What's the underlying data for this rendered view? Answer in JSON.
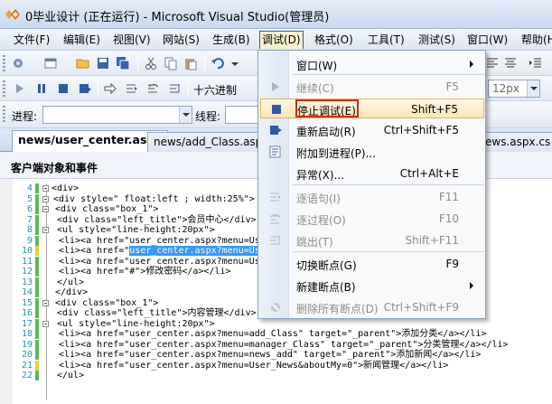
{
  "window": {
    "title": "0毕业设计 (正在运行) - Microsoft Visual Studio(管理员)"
  },
  "menubar": {
    "items": [
      "文件(F)",
      "编辑(E)",
      "视图(V)",
      "网站(S)",
      "生成(B)",
      "调试(D)",
      "格式(O)",
      "工具(T)",
      "测试(S)",
      "窗口(W)",
      "帮助(H)"
    ],
    "active_index": 5
  },
  "toolbar3": {
    "process_label": "进程:",
    "thread_label": "线程:"
  },
  "toolbar2": {
    "hex_label": "十六进制",
    "font_size": "12px"
  },
  "tabs": [
    "news/user_center.aspx",
    "news/add_Class.asp",
    "ews.aspx.cs"
  ],
  "objbar": {
    "label": "客户端对象和事件"
  },
  "code_lines": [
    {
      "n": "4",
      "text": "<div>"
    },
    {
      "n": "5",
      "text": "<div style=\" float:left ; width:25%\">"
    },
    {
      "n": "6",
      "text": "<div class=\"box_1\">"
    },
    {
      "n": "7",
      "text": "<div class=\"left_title\">会员中心</div>"
    },
    {
      "n": "8",
      "text": "<ul style=\"line-height:20px\">"
    },
    {
      "n": "9",
      "text": "<li><a href=\"user_center.aspx?menu=Us"
    },
    {
      "n": "10",
      "text": "<li><a href=\"user_center.aspx?menu=Us"
    },
    {
      "n": "11",
      "text": "<li><a href=\"user_center.aspx?menu=Us"
    },
    {
      "n": "12",
      "text": "<li><a href=\"#\">修改密码</a></li>"
    },
    {
      "n": "13",
      "text": "</ul>"
    },
    {
      "n": "14",
      "text": "</div>"
    },
    {
      "n": "15",
      "text": "<div class=\"box_1\">"
    },
    {
      "n": "16",
      "text": "<div class=\"left_title\">内容管理</div>"
    },
    {
      "n": "17",
      "text": "<ul style=\"line-height:20px\">"
    },
    {
      "n": "18",
      "text": "<li><a href=\"user_center.aspx?menu=add_Class\" target=\"_parent\">添加分类</a></li>"
    },
    {
      "n": "19",
      "text": "<li><a href=\"user_center.aspx?menu=manager_Class\" target=\"_parent\">分类管理</a></li>"
    },
    {
      "n": "20",
      "text": "<li><a href=\"user_center.aspx?menu=news_add\" target=\"_parent\">添加新闻</a></li>"
    },
    {
      "n": "21",
      "text": "<li><a href=\"user_center.aspx?menu=User_News&aboutMy=0\">新闻管理</a></li>"
    },
    {
      "n": "22",
      "text": "</ul>"
    }
  ],
  "debug_menu": {
    "items": [
      {
        "label": "窗口(W)",
        "shortcut": "",
        "submenu": true,
        "disabled": false,
        "icon": "none"
      },
      {
        "label": "继续(C)",
        "shortcut": "F5",
        "submenu": false,
        "disabled": true,
        "icon": "play-icon"
      },
      {
        "label": "停止调试(E)",
        "shortcut": "Shift+F5",
        "submenu": false,
        "disabled": false,
        "icon": "stop-icon"
      },
      {
        "label": "重新启动(R)",
        "shortcut": "Ctrl+Shift+F5",
        "submenu": false,
        "disabled": false,
        "icon": "restart-icon"
      },
      {
        "label": "附加到进程(P)...",
        "shortcut": "",
        "submenu": false,
        "disabled": false,
        "icon": "attach-icon"
      },
      {
        "label": "异常(X)...",
        "shortcut": "Ctrl+Alt+E",
        "submenu": false,
        "disabled": false,
        "icon": "none"
      },
      {
        "label": "逐语句(I)",
        "shortcut": "F11",
        "submenu": false,
        "disabled": true,
        "icon": "step-into-icon"
      },
      {
        "label": "逐过程(O)",
        "shortcut": "F10",
        "submenu": false,
        "disabled": true,
        "icon": "step-over-icon"
      },
      {
        "label": "跳出(T)",
        "shortcut": "Shift+F11",
        "submenu": false,
        "disabled": true,
        "icon": "step-out-icon"
      },
      {
        "label": "切换断点(G)",
        "shortcut": "F9",
        "submenu": false,
        "disabled": false,
        "icon": "none"
      },
      {
        "label": "新建断点(B)",
        "shortcut": "",
        "submenu": true,
        "disabled": false,
        "icon": "none"
      },
      {
        "label": "删除所有断点(D)",
        "shortcut": "Ctrl+Shift+F9",
        "submenu": false,
        "disabled": true,
        "icon": "delete-breakpoints-icon"
      }
    ],
    "highlighted_index": 2
  },
  "colors": {
    "highlight_box": "#d9261c",
    "selection": "#3399ff"
  }
}
